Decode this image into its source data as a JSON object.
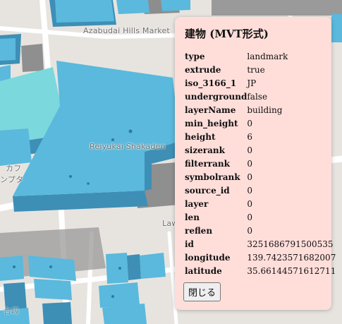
{
  "map": {
    "labels": {
      "market": "Azabudai Hills Market",
      "reiyukai": "Reiyukai Shakaden",
      "jp_fragment_left": "ンプタ",
      "jp_fragment_left2": "カフ",
      "law_fragment": "Law",
      "jp_fragment_bottom": "台段"
    },
    "colors": {
      "ground": "#e7e4e0",
      "road": "#ffffff",
      "building_top": "#5ab9dc",
      "building_side": "#3d8fb6",
      "building_cyan": "#7bd8dc",
      "building_gray": "#8f8f8f"
    }
  },
  "popup": {
    "title": "建物 (MVT形式)",
    "rows": [
      {
        "key": "type",
        "value": "landmark"
      },
      {
        "key": "extrude",
        "value": "true"
      },
      {
        "key": "iso_3166_1",
        "value": "JP"
      },
      {
        "key": "underground",
        "value": "false"
      },
      {
        "key": "layerName",
        "value": "building"
      },
      {
        "key": "min_height",
        "value": "0"
      },
      {
        "key": "height",
        "value": "6"
      },
      {
        "key": "sizerank",
        "value": "0"
      },
      {
        "key": "filterrank",
        "value": "0"
      },
      {
        "key": "symbolrank",
        "value": "0"
      },
      {
        "key": "source_id",
        "value": "0"
      },
      {
        "key": "layer",
        "value": "0"
      },
      {
        "key": "len",
        "value": "0"
      },
      {
        "key": "reflen",
        "value": "0"
      },
      {
        "key": "id",
        "value": "3251686791500535"
      },
      {
        "key": "longitude",
        "value": "139.7423571682007"
      },
      {
        "key": "latitude",
        "value": "35.66144571612711"
      }
    ],
    "close_label": "閉じる",
    "background": "#ffdeda"
  }
}
